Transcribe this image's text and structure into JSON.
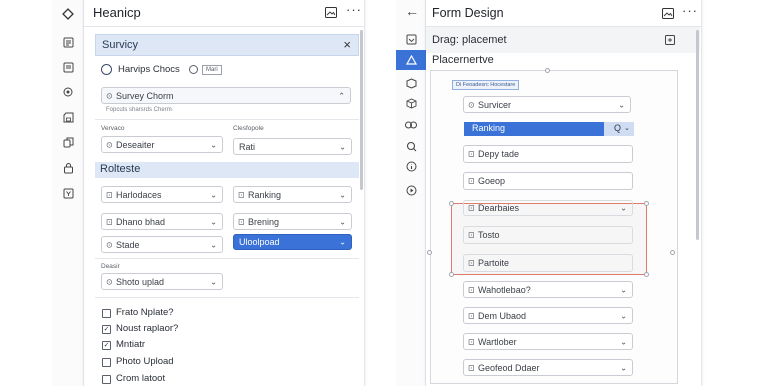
{
  "left_panel": {
    "title": "Heanicp",
    "section_survey": {
      "title": "Survicy"
    },
    "choices_row": {
      "label": "Harvips Chocs",
      "badge": "Mari"
    },
    "survey_select": {
      "value": "Survey Chorm"
    },
    "small_caption_1": "Vervaco",
    "small_caption_2": "Clesfopole",
    "survey_helper": "Fopcuts sharsrds Cherm·",
    "field_desc": {
      "value": "Deseaiter"
    },
    "field_rati": {
      "value": "Rati"
    },
    "section_rolteste": {
      "title": "Rolteste"
    },
    "fields": [
      {
        "value": "Harlodaces"
      },
      {
        "value": "Ranking"
      },
      {
        "value": "Dhano bhad"
      },
      {
        "value": "Brening"
      },
      {
        "value": "Stade"
      },
      {
        "value": "Uloolpoad"
      }
    ],
    "small_caption_3": "Deasir",
    "shoto_field": {
      "value": "Shoto uplad"
    },
    "checklist": [
      "Frato Nplate?",
      "Noust raplaor?",
      "Mntiatr",
      "Photo Upload",
      "Crom latoot"
    ]
  },
  "right_panel": {
    "title": "Form Design",
    "subtitle": "Drag: placemet",
    "section_label": "Placernertve",
    "inner_tag": "Di Feoadesrc Hocestare",
    "fields": [
      {
        "value": "Survicer"
      },
      {
        "value": "Ranking"
      },
      {
        "value": "Depy tade"
      },
      {
        "value": "Goeop"
      },
      {
        "value": "Dearbaies"
      },
      {
        "value": "Tosto"
      },
      {
        "value": "Partoite"
      },
      {
        "value": "Wahotlebao?"
      },
      {
        "value": "Dem Ubaod"
      },
      {
        "value": "Wartlober"
      },
      {
        "value": "Geofeod Ddaer"
      }
    ]
  },
  "colors": {
    "accent": "#3a72d8",
    "section_bg": "#dde7f5",
    "selection": "#e07a6c"
  }
}
